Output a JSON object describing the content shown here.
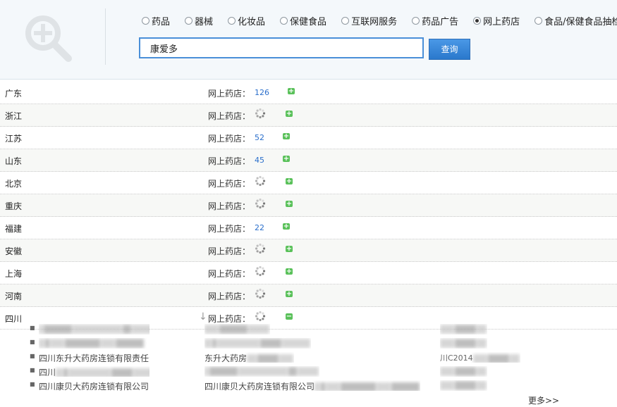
{
  "search": {
    "categories": [
      {
        "label": "药品",
        "selected": false
      },
      {
        "label": "器械",
        "selected": false
      },
      {
        "label": "化妆品",
        "selected": false
      },
      {
        "label": "保健食品",
        "selected": false
      },
      {
        "label": "互联网服务",
        "selected": false
      },
      {
        "label": "药品广告",
        "selected": false
      },
      {
        "label": "网上药店",
        "selected": true
      },
      {
        "label": "食品/保健食品抽检",
        "selected": false
      }
    ],
    "query": "康爱多",
    "button_label": "查询"
  },
  "rows": [
    {
      "province": "广东",
      "label": "网上药店：",
      "count": "126",
      "loading": false,
      "expanded": false
    },
    {
      "province": "浙江",
      "label": "网上药店：",
      "count": "",
      "loading": true,
      "expanded": false
    },
    {
      "province": "江苏",
      "label": "网上药店：",
      "count": "52",
      "loading": false,
      "expanded": false
    },
    {
      "province": "山东",
      "label": "网上药店：",
      "count": "45",
      "loading": false,
      "expanded": false
    },
    {
      "province": "北京",
      "label": "网上药店：",
      "count": "",
      "loading": true,
      "expanded": false
    },
    {
      "province": "重庆",
      "label": "网上药店：",
      "count": "",
      "loading": true,
      "expanded": false
    },
    {
      "province": "福建",
      "label": "网上药店：",
      "count": "22",
      "loading": false,
      "expanded": false
    },
    {
      "province": "安徽",
      "label": "网上药店：",
      "count": "",
      "loading": true,
      "expanded": false
    },
    {
      "province": "上海",
      "label": "网上药店：",
      "count": "",
      "loading": true,
      "expanded": false
    },
    {
      "province": "河南",
      "label": "网上药店：",
      "count": "",
      "loading": true,
      "expanded": false
    },
    {
      "province": "四川",
      "label": "网上药店：",
      "count": "",
      "loading": true,
      "expanded": true
    }
  ],
  "results": [
    {
      "company": "",
      "store": "",
      "license": "",
      "blurred": true
    },
    {
      "company": "",
      "store": "",
      "license": "",
      "blurred": true
    },
    {
      "company": "四川东升大药房连锁有限责任公司",
      "store": "东升大药房",
      "license": "川C2014",
      "blurred": false
    },
    {
      "company": "四川",
      "store": "",
      "license": "",
      "blurred": true
    },
    {
      "company": "四川康贝大药房连锁有限公司",
      "store": "四川康贝大药房连锁有限公司",
      "license": "",
      "blurred": false
    }
  ],
  "more_label": "更多>>"
}
